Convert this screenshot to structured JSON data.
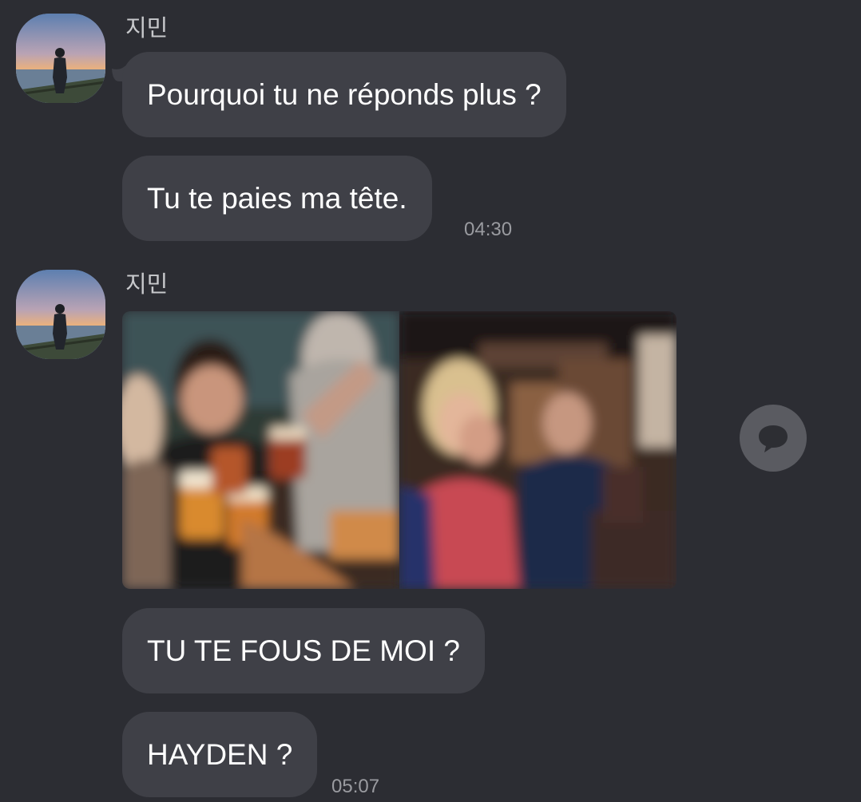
{
  "conversation": {
    "groups": [
      {
        "sender": "지민",
        "messages": [
          {
            "text": "Pourquoi tu ne réponds plus ?"
          },
          {
            "text": "Tu te paies ma tête.",
            "time": "04:30"
          }
        ]
      },
      {
        "sender": "지민",
        "attachment": {
          "type": "photo-pair",
          "count": 2
        },
        "messages": [
          {
            "text": "TU TE FOUS DE MOI ?"
          },
          {
            "text": "HAYDEN ?",
            "time": "05:07"
          }
        ]
      }
    ]
  },
  "icons": {
    "avatar": "profile-photo",
    "share": "speech-bubble-icon"
  },
  "colors": {
    "background": "#2c2d33",
    "bubble": "#3f4047",
    "message_text": "#ffffff",
    "sender_text": "#c8c9cc",
    "time_text": "#9a9ba0",
    "share_button": "#5a5b61"
  }
}
